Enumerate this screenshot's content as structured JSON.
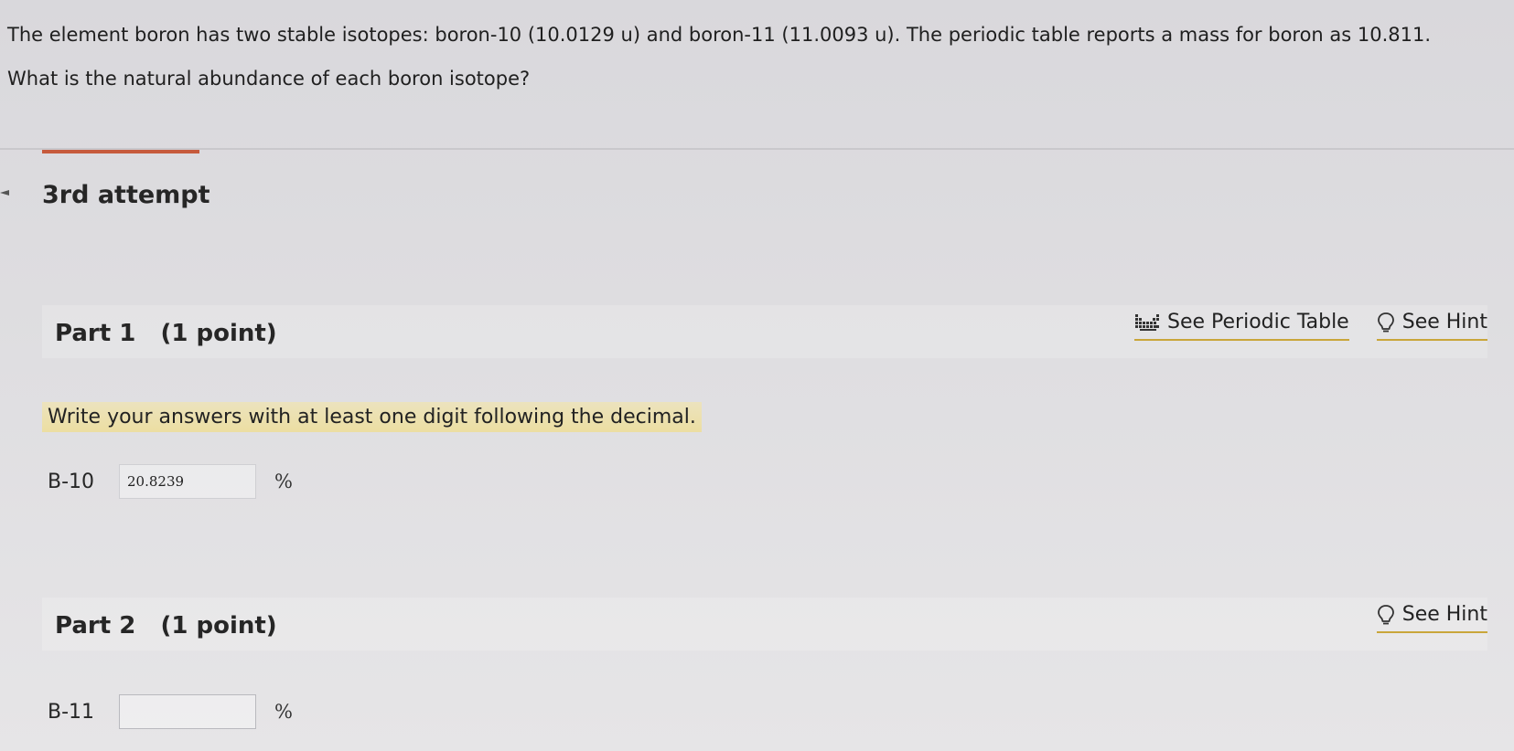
{
  "question": {
    "line1": "The element boron has two stable isotopes: boron-10 (10.0129 u) and boron-11 (11.0093 u). The periodic table reports a mass for boron as 10.811.",
    "line2": "What is the natural abundance of each boron isotope?"
  },
  "attempt": {
    "title": "3rd attempt"
  },
  "colors": {
    "accent": "#c65a3c",
    "highlight": "#f0de8c",
    "link_underline": "#c9a63a"
  },
  "part1": {
    "title": "Part 1   (1 point)",
    "periodic_table_label": "See Periodic Table",
    "periodic_table_icon": "periodic-table-icon",
    "hint_label": "See Hint",
    "hint_icon": "lightbulb-icon",
    "instruction": "Write your answers with at least one digit following the decimal.",
    "answer": {
      "label": "B-10",
      "value": "20.8239",
      "unit": "%"
    }
  },
  "part2": {
    "title": "Part 2   (1 point)",
    "hint_label": "See Hint",
    "hint_icon": "lightbulb-icon",
    "answer": {
      "label": "B-11",
      "value": "",
      "unit": "%"
    }
  }
}
